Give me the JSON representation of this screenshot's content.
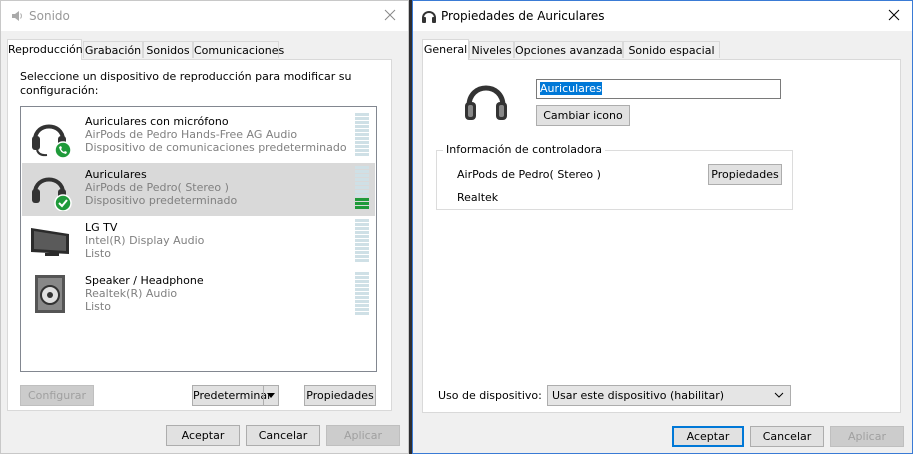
{
  "sound_window": {
    "title": "Sonido",
    "tabs": [
      "Reproducción",
      "Grabación",
      "Sonidos",
      "Comunicaciones"
    ],
    "instruction": "Seleccione un dispositivo de reproducción para modificar su configuración:",
    "devices": [
      {
        "name": "Auriculares con micrófono",
        "line2": "AirPods de Pedro Hands-Free AG Audio",
        "line3": "Dispositivo de comunicaciones predeterminado",
        "icon": "headset-phone-icon",
        "level": 0
      },
      {
        "name": "Auriculares",
        "line2": "AirPods de Pedro( Stereo )",
        "line3": "Dispositivo predeterminado",
        "icon": "headphones-check-icon",
        "level": 0.3
      },
      {
        "name": "LG TV",
        "line2": "Intel(R) Display Audio",
        "line3": "Listo",
        "icon": "monitor-icon",
        "level": 0
      },
      {
        "name": "Speaker / Headphone",
        "line2": "Realtek(R) Audio",
        "line3": "Listo",
        "icon": "speaker-icon",
        "level": 0
      }
    ],
    "buttons": {
      "configure": "Configurar",
      "set_default": "Predeterminar",
      "properties": "Propiedades",
      "ok": "Aceptar",
      "cancel": "Cancelar",
      "apply": "Aplicar"
    }
  },
  "props_window": {
    "title": "Propiedades de Auriculares",
    "tabs": [
      "General",
      "Niveles",
      "Opciones avanzadas",
      "Sonido espacial"
    ],
    "device_name_value": "Auriculares",
    "change_icon": "Cambiar icono",
    "controller_group": "Información de controladora",
    "controller_name": "AirPods de Pedro( Stereo )",
    "controller_properties": "Propiedades",
    "vendor": "Realtek",
    "usage_label": "Uso de dispositivo:",
    "usage_value": "Usar este dispositivo (habilitar)",
    "buttons": {
      "ok": "Aceptar",
      "cancel": "Cancelar",
      "apply": "Aplicar"
    }
  },
  "colors": {
    "accent": "#0078d7",
    "check_green": "#1f9a3a",
    "selection": "#d9d9d9"
  }
}
